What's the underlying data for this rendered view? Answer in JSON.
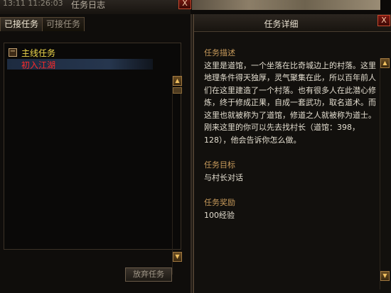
{
  "top_bar": {
    "time": "13:11 11:26:03",
    "title": "任务日志",
    "close_label": "X"
  },
  "tabs": [
    {
      "label": "已接任务",
      "active": true
    },
    {
      "label": "可接任务",
      "active": false
    }
  ],
  "quest_list": {
    "group_label": "主线任务",
    "expand_symbol": "−",
    "items": [
      "初入江湖"
    ]
  },
  "scroll_symbols": {
    "up": "▲",
    "down": "▼"
  },
  "abandon_button": "放弃任务",
  "detail": {
    "header_title": "任务详细",
    "desc_title": "任务描述",
    "desc_text": "这里是道馆，一个坐落在比奇城边上的村落。这里地理条件得天独厚，灵气聚集在此，所以百年前人们在这里建造了一个村落。也有很多人在此潜心修炼，终于修成正果，自成一套武功，取名道术。而这里也就被称为了道馆，修道之人就被称为道士。刚来这里的你可以先去找村长（道馆：398，128），他会告诉你怎么做。",
    "goal_title": "任务目标",
    "goal_text": "与村长对话",
    "reward_title": "任务奖励",
    "reward_text": "100经验"
  },
  "colors": {
    "group_yellow": "#f0d84c",
    "item_red": "#ff2a2a",
    "section_gold": "#c79a5b"
  }
}
